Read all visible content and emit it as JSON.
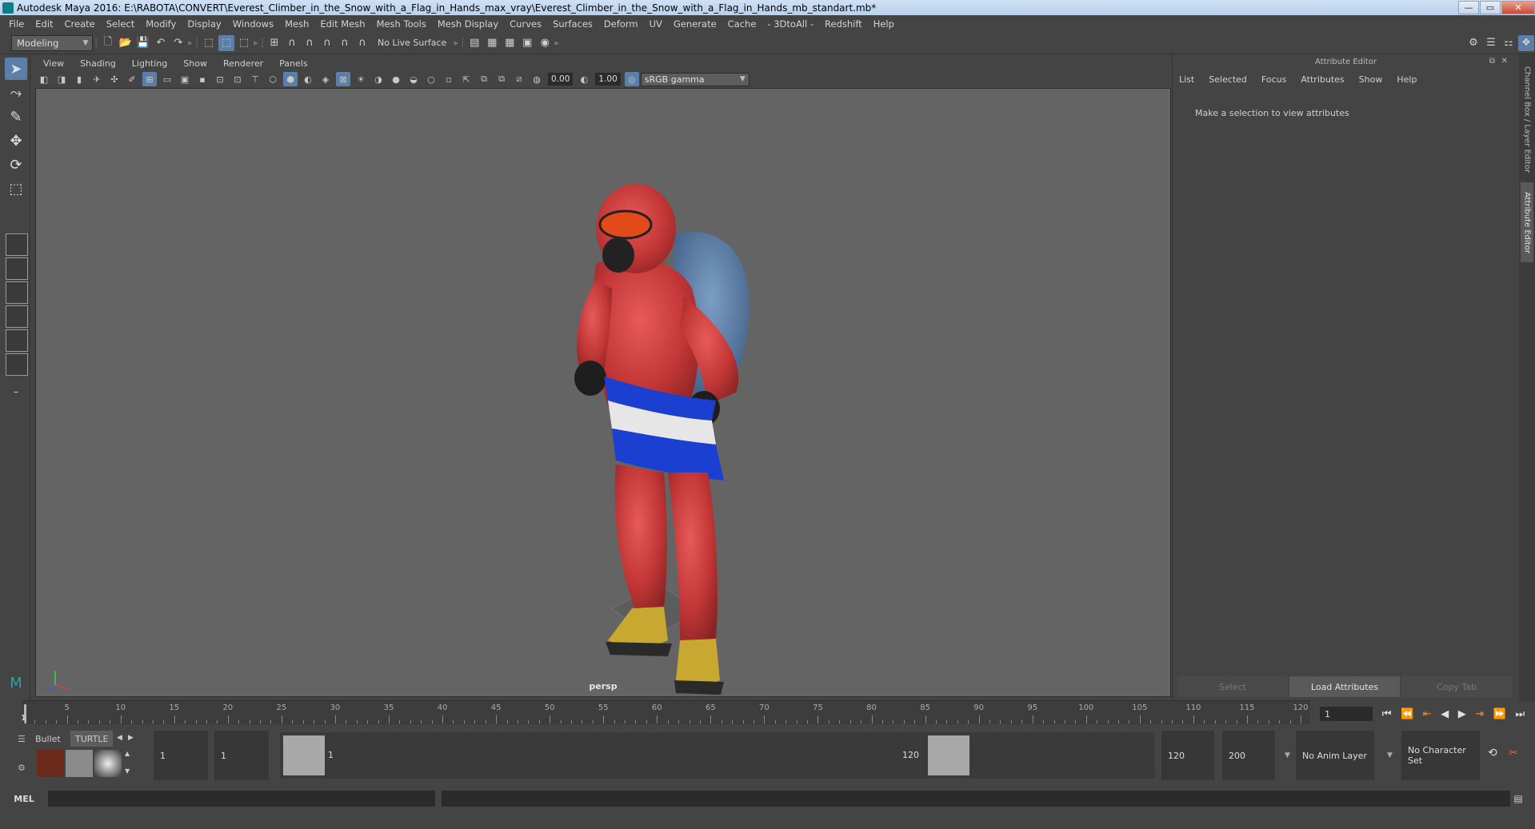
{
  "window": {
    "title": "Autodesk Maya 2016: E:\\RABOTA\\CONVERT\\Everest_Climber_in_the_Snow_with_a_Flag_in_Hands_max_vray\\Everest_Climber_in_the_Snow_with_a_Flag_in_Hands_mb_standart.mb*",
    "minimize": "—",
    "maximize": "▭",
    "close": "✕"
  },
  "menubar": [
    "File",
    "Edit",
    "Create",
    "Select",
    "Modify",
    "Display",
    "Windows",
    "Mesh",
    "Edit Mesh",
    "Mesh Tools",
    "Mesh Display",
    "Curves",
    "Surfaces",
    "Deform",
    "UV",
    "Generate",
    "Cache",
    "- 3DtoAll -",
    "Redshift",
    "Help"
  ],
  "toolbar": {
    "mode": "Modeling",
    "live_surface": "No Live Surface"
  },
  "viewport": {
    "menu": [
      "View",
      "Shading",
      "Lighting",
      "Show",
      "Renderer",
      "Panels"
    ],
    "exposure": "0.00",
    "gamma_value": "1.00",
    "color_space": "sRGB gamma",
    "camera_label": "persp"
  },
  "attribute_editor": {
    "title": "Attribute Editor",
    "menu": [
      "List",
      "Selected",
      "Focus",
      "Attributes",
      "Show",
      "Help"
    ],
    "message": "Make a selection to view attributes",
    "buttons": {
      "select": "Select",
      "load": "Load Attributes",
      "copy_tab": "Copy Tab"
    }
  },
  "side_tabs": {
    "channel_box": "Channel Box / Layer Editor",
    "attr_editor": "Attribute Editor"
  },
  "time_slider": {
    "ticks": [
      5,
      10,
      15,
      20,
      25,
      30,
      35,
      40,
      45,
      50,
      55,
      60,
      65,
      70,
      75,
      80,
      85,
      90,
      95,
      100,
      105,
      110,
      115,
      120
    ],
    "current_frame": "1",
    "frame_field": "1"
  },
  "shelf": {
    "tabs": [
      "Bullet",
      "TURTLE"
    ]
  },
  "range": {
    "start_outer": "1",
    "start_inner": "1",
    "handle_start": "1",
    "handle_end": "120",
    "end_inner": "120",
    "end_outer": "200",
    "anim_layer": "No Anim Layer",
    "char_set": "No Character Set"
  },
  "command_line": {
    "label": "MEL"
  },
  "colors": {
    "accent": "#5b7fa8",
    "viewport_bg": "#646464",
    "panel_bg": "#444444"
  }
}
